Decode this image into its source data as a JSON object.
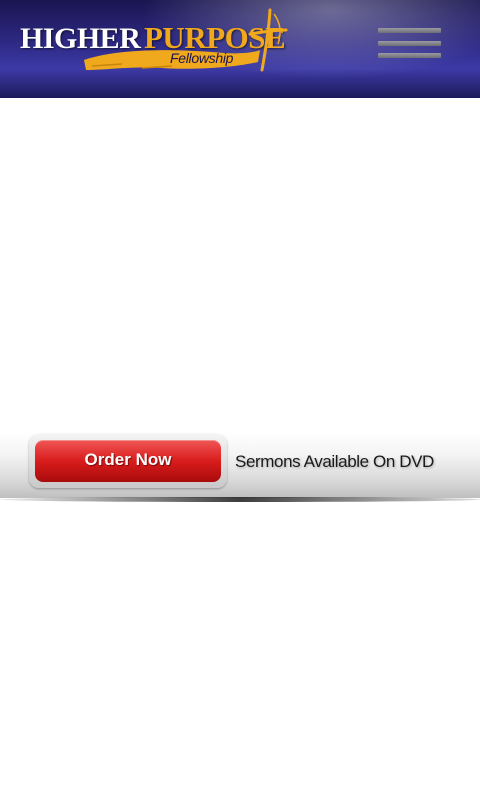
{
  "header": {
    "logo": {
      "word_primary": "HIGHER",
      "word_accent": "PURPOSE",
      "subtitle": "Fellowship"
    },
    "menu_icon": "hamburger-menu-icon"
  },
  "banner": {
    "order_label": "Order Now",
    "tagline": "Sermons Available On DVD"
  },
  "colors": {
    "header_bg": "#2e2a86",
    "logo_accent": "#f0a81c",
    "order_button": "#d91c1c"
  }
}
